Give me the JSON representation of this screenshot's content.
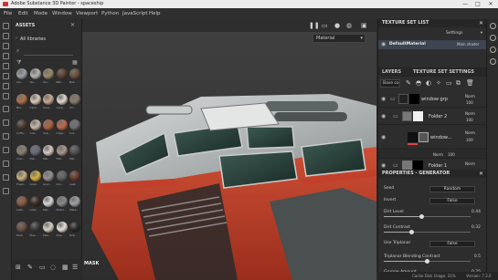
{
  "window": {
    "title": "Adobe Substance 3D Painter - spaceship",
    "controls": [
      "—",
      "□",
      "✕"
    ]
  },
  "menu": [
    "File",
    "Edit",
    "Mode",
    "Window",
    "Viewport",
    "Python",
    "JavaScript",
    "Help"
  ],
  "assets": {
    "title": "ASSETS",
    "library": "All libraries",
    "search_icon": "search-icon",
    "materials": [
      "Alu..",
      "Alu..",
      "Alu..",
      "Bak..",
      "Bak..",
      "Bro..",
      "Cera..",
      "Cera..",
      "Cera..",
      "Chi..",
      "Coffe..",
      "Coll..",
      "Cop..",
      "Copp..",
      "Cot..",
      "Crac..",
      "Fab..",
      "Fab..",
      "Fab..",
      "Fab..",
      "Foam..",
      "Gold..",
      "Gran..",
      "Iron..",
      "Leat..",
      "Leat..",
      "Leat..",
      "Mar..",
      "Metal..",
      "Meta..",
      "Mud..",
      "Plas..",
      "Plas..",
      "Plas..",
      "Rub..",
      "Sand..",
      "Silv..",
      "Skin..",
      "Stee..",
      "Ston.."
    ]
  },
  "viewport": {
    "material_selector": "Material",
    "mask_label": "MASK"
  },
  "texture_set_list": {
    "title": "TEXTURE SET LIST",
    "settings_label": "Settings",
    "item_name": "DefaultMaterial",
    "shader": "Main shader"
  },
  "layers_tabs": {
    "layers": "LAYERS",
    "settings": "TEXTURE SET SETTINGS"
  },
  "layers_toolbar": {
    "channel": "Base co"
  },
  "layers": [
    {
      "name": "window grp",
      "blend": "Norm",
      "opacity": "100"
    },
    {
      "name": "Folder 2",
      "blend": "Norm",
      "opacity": "100"
    },
    {
      "name": "window...",
      "blend": "Norm",
      "opacity": "100"
    },
    {
      "name": "",
      "blend": "Norm",
      "opacity": "100"
    },
    {
      "name": "Folder 1",
      "blend": "Norm",
      "opacity": "100"
    }
  ],
  "properties": {
    "title": "PROPERTIES - GENERATOR",
    "rows": [
      {
        "label": "Seed",
        "type": "button",
        "value": "Random"
      },
      {
        "label": "Invert",
        "type": "button",
        "value": "False"
      },
      {
        "label": "Dirt Level",
        "type": "slider",
        "value": "0.44",
        "fraction": 0.44
      },
      {
        "label": "Dirt Contrast",
        "type": "slider",
        "value": "0.32",
        "fraction": 0.32
      },
      {
        "label": "Use Triplanar",
        "type": "button",
        "value": "False"
      },
      {
        "label": "Triplanar Blending Contrast",
        "type": "slider",
        "value": "0.5",
        "fraction": 0.5
      },
      {
        "label": "Grunge Amount",
        "type": "slider",
        "value": "0.25",
        "fraction": 0.25
      }
    ]
  },
  "status": {
    "cache": "Cache Disk Usage: 31%",
    "version": "Version: 7.3.0"
  }
}
